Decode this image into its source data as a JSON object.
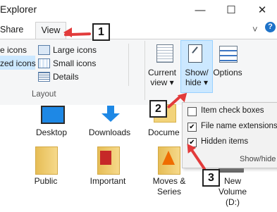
{
  "window": {
    "title": "Explorer",
    "minimize": "—",
    "maximize": "☐",
    "close": "✕"
  },
  "tabs": {
    "share": "Share",
    "view": "View"
  },
  "ribbon": {
    "layout_items": [
      "e icons",
      "Large icons",
      "zed icons",
      "Small icons",
      "Details"
    ],
    "layout_label": "Layout",
    "current_view": [
      "Current",
      "view ▾"
    ],
    "show_hide": [
      "Show/",
      "hide ▾"
    ],
    "options": "Options",
    "up_arrow": "˅",
    "help": "?"
  },
  "content": {
    "items": [
      "Desktop",
      "Downloads",
      "Docume",
      "Public",
      "Important",
      "Moves &",
      "Series",
      "New",
      "Volume",
      "(D:)"
    ]
  },
  "menu": {
    "items": [
      {
        "label": "Item check boxes",
        "checked": false
      },
      {
        "label": "File name extensions",
        "checked": true
      },
      {
        "label": "Hidden items",
        "checked": true
      }
    ],
    "footer": "Show/hide",
    "check_glyph": "✔"
  },
  "annotations": {
    "badge1": "1",
    "badge2": "2",
    "badge3": "3",
    "accent": "#e23b3b"
  }
}
